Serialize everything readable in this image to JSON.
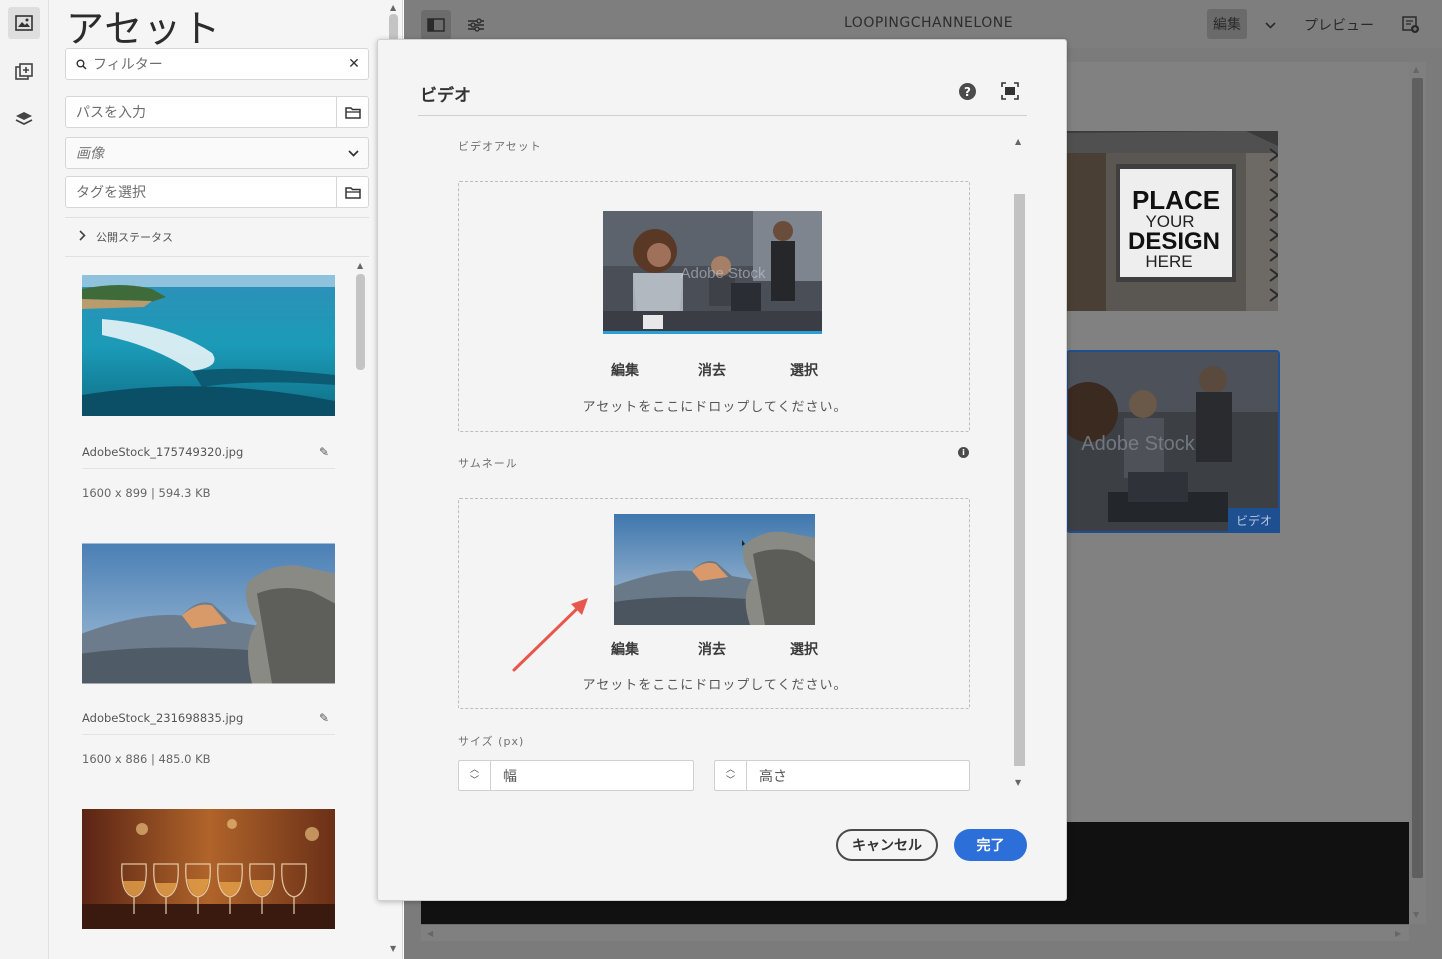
{
  "assets_panel": {
    "title": "アセット",
    "filter_placeholder": "フィルター",
    "path_placeholder": "パスを入力",
    "type_select_value": "画像",
    "tag_placeholder": "タグを選択",
    "publish_status_label": "公開ステータス",
    "items": [
      {
        "name": "AdobeStock_175749320.jpg",
        "meta": "1600 x 899 | 594.3 KB"
      },
      {
        "name": "AdobeStock_231698835.jpg",
        "meta": "1600 x 886 | 485.0 KB"
      },
      {
        "name": "",
        "meta": ""
      }
    ]
  },
  "topbar": {
    "channel_name": "LOOPINGCHANNELONE",
    "edit_label": "編集",
    "preview_label": "プレビュー"
  },
  "canvas": {
    "poster_lines": [
      "PLACE",
      "YOUR",
      "DESIGN",
      "HERE"
    ],
    "video_watermark": "Adobe Stock",
    "video_tag": "ビデオ"
  },
  "dialog": {
    "title": "ビデオ",
    "video_asset_label": "ビデオアセット",
    "thumbnail_label": "サムネール",
    "video_watermark": "Adobe Stock",
    "actions": {
      "edit": "編集",
      "clear": "消去",
      "select": "選択"
    },
    "drop_hint": "アセットをここにドロップしてください。",
    "size_label": "サイズ (px)",
    "width_placeholder": "幅",
    "height_placeholder": "高さ",
    "cancel_label": "キャンセル",
    "done_label": "完了"
  },
  "colors": {
    "accent": "#2c6fd9",
    "selection": "#1d4f91",
    "annotation_arrow": "#e8574b"
  }
}
